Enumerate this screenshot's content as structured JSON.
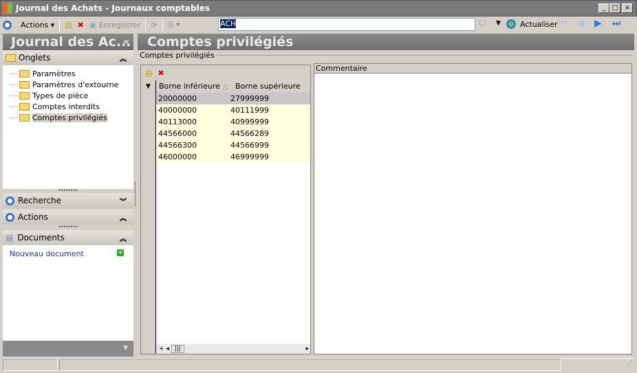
{
  "window": {
    "title": "Journal des Achats -  Journaux comptables"
  },
  "toolbar": {
    "actions": "Actions",
    "save": "Enregistrer",
    "search_value": "ACH",
    "refresh": "Actualiser"
  },
  "left": {
    "header": "Journal des Ac...",
    "collapse": "«",
    "tabs_section": "Onglets",
    "tree": [
      "Paramètres",
      "Paramètres d'extourne",
      "Types de pièce",
      "Comptes interdits",
      "Comptes privilégiés"
    ],
    "search_section": "Recherche",
    "actions_section": "Actions",
    "documents_section": "Documents",
    "new_document": "Nouveau document"
  },
  "main": {
    "header": "Comptes privilégiés",
    "group_label": "Comptes privilégiés",
    "columns": [
      "Borne inférieure",
      "Borne supérieure"
    ],
    "rows": [
      [
        "20000000",
        "27999999"
      ],
      [
        "40000000",
        "40111999"
      ],
      [
        "40113000",
        "40999999"
      ],
      [
        "44566000",
        "44566289"
      ],
      [
        "44566300",
        "44566999"
      ],
      [
        "46000000",
        "46999999"
      ]
    ],
    "comment_label": "Commentaire"
  }
}
